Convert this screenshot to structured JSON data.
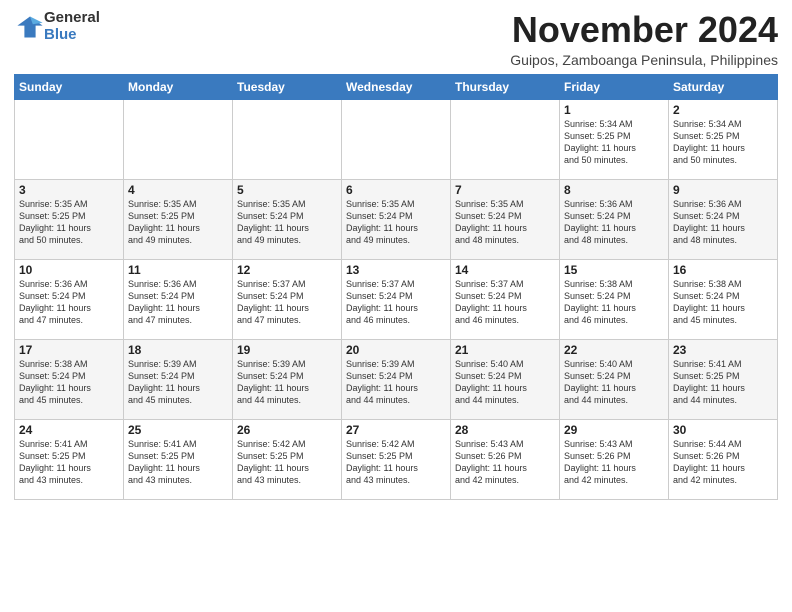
{
  "header": {
    "logo_general": "General",
    "logo_blue": "Blue",
    "month_title": "November 2024",
    "subtitle": "Guipos, Zamboanga Peninsula, Philippines"
  },
  "weekdays": [
    "Sunday",
    "Monday",
    "Tuesday",
    "Wednesday",
    "Thursday",
    "Friday",
    "Saturday"
  ],
  "weeks": [
    [
      {
        "day": "",
        "info": ""
      },
      {
        "day": "",
        "info": ""
      },
      {
        "day": "",
        "info": ""
      },
      {
        "day": "",
        "info": ""
      },
      {
        "day": "",
        "info": ""
      },
      {
        "day": "1",
        "info": "Sunrise: 5:34 AM\nSunset: 5:25 PM\nDaylight: 11 hours\nand 50 minutes."
      },
      {
        "day": "2",
        "info": "Sunrise: 5:34 AM\nSunset: 5:25 PM\nDaylight: 11 hours\nand 50 minutes."
      }
    ],
    [
      {
        "day": "3",
        "info": "Sunrise: 5:35 AM\nSunset: 5:25 PM\nDaylight: 11 hours\nand 50 minutes."
      },
      {
        "day": "4",
        "info": "Sunrise: 5:35 AM\nSunset: 5:25 PM\nDaylight: 11 hours\nand 49 minutes."
      },
      {
        "day": "5",
        "info": "Sunrise: 5:35 AM\nSunset: 5:24 PM\nDaylight: 11 hours\nand 49 minutes."
      },
      {
        "day": "6",
        "info": "Sunrise: 5:35 AM\nSunset: 5:24 PM\nDaylight: 11 hours\nand 49 minutes."
      },
      {
        "day": "7",
        "info": "Sunrise: 5:35 AM\nSunset: 5:24 PM\nDaylight: 11 hours\nand 48 minutes."
      },
      {
        "day": "8",
        "info": "Sunrise: 5:36 AM\nSunset: 5:24 PM\nDaylight: 11 hours\nand 48 minutes."
      },
      {
        "day": "9",
        "info": "Sunrise: 5:36 AM\nSunset: 5:24 PM\nDaylight: 11 hours\nand 48 minutes."
      }
    ],
    [
      {
        "day": "10",
        "info": "Sunrise: 5:36 AM\nSunset: 5:24 PM\nDaylight: 11 hours\nand 47 minutes."
      },
      {
        "day": "11",
        "info": "Sunrise: 5:36 AM\nSunset: 5:24 PM\nDaylight: 11 hours\nand 47 minutes."
      },
      {
        "day": "12",
        "info": "Sunrise: 5:37 AM\nSunset: 5:24 PM\nDaylight: 11 hours\nand 47 minutes."
      },
      {
        "day": "13",
        "info": "Sunrise: 5:37 AM\nSunset: 5:24 PM\nDaylight: 11 hours\nand 46 minutes."
      },
      {
        "day": "14",
        "info": "Sunrise: 5:37 AM\nSunset: 5:24 PM\nDaylight: 11 hours\nand 46 minutes."
      },
      {
        "day": "15",
        "info": "Sunrise: 5:38 AM\nSunset: 5:24 PM\nDaylight: 11 hours\nand 46 minutes."
      },
      {
        "day": "16",
        "info": "Sunrise: 5:38 AM\nSunset: 5:24 PM\nDaylight: 11 hours\nand 45 minutes."
      }
    ],
    [
      {
        "day": "17",
        "info": "Sunrise: 5:38 AM\nSunset: 5:24 PM\nDaylight: 11 hours\nand 45 minutes."
      },
      {
        "day": "18",
        "info": "Sunrise: 5:39 AM\nSunset: 5:24 PM\nDaylight: 11 hours\nand 45 minutes."
      },
      {
        "day": "19",
        "info": "Sunrise: 5:39 AM\nSunset: 5:24 PM\nDaylight: 11 hours\nand 44 minutes."
      },
      {
        "day": "20",
        "info": "Sunrise: 5:39 AM\nSunset: 5:24 PM\nDaylight: 11 hours\nand 44 minutes."
      },
      {
        "day": "21",
        "info": "Sunrise: 5:40 AM\nSunset: 5:24 PM\nDaylight: 11 hours\nand 44 minutes."
      },
      {
        "day": "22",
        "info": "Sunrise: 5:40 AM\nSunset: 5:24 PM\nDaylight: 11 hours\nand 44 minutes."
      },
      {
        "day": "23",
        "info": "Sunrise: 5:41 AM\nSunset: 5:25 PM\nDaylight: 11 hours\nand 44 minutes."
      }
    ],
    [
      {
        "day": "24",
        "info": "Sunrise: 5:41 AM\nSunset: 5:25 PM\nDaylight: 11 hours\nand 43 minutes."
      },
      {
        "day": "25",
        "info": "Sunrise: 5:41 AM\nSunset: 5:25 PM\nDaylight: 11 hours\nand 43 minutes."
      },
      {
        "day": "26",
        "info": "Sunrise: 5:42 AM\nSunset: 5:25 PM\nDaylight: 11 hours\nand 43 minutes."
      },
      {
        "day": "27",
        "info": "Sunrise: 5:42 AM\nSunset: 5:25 PM\nDaylight: 11 hours\nand 43 minutes."
      },
      {
        "day": "28",
        "info": "Sunrise: 5:43 AM\nSunset: 5:26 PM\nDaylight: 11 hours\nand 42 minutes."
      },
      {
        "day": "29",
        "info": "Sunrise: 5:43 AM\nSunset: 5:26 PM\nDaylight: 11 hours\nand 42 minutes."
      },
      {
        "day": "30",
        "info": "Sunrise: 5:44 AM\nSunset: 5:26 PM\nDaylight: 11 hours\nand 42 minutes."
      }
    ]
  ]
}
